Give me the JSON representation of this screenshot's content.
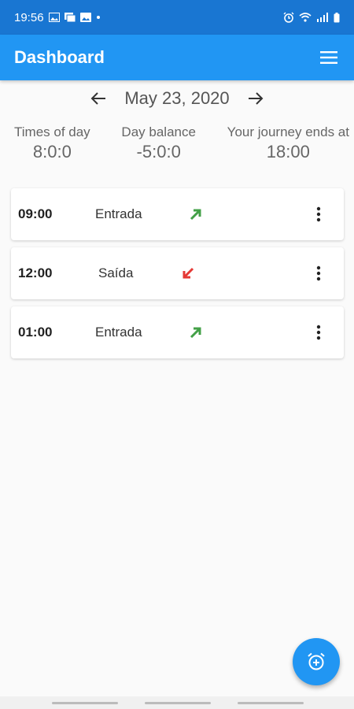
{
  "status_bar": {
    "time": "19:56",
    "left_icons": [
      "image-icon",
      "messages-icon",
      "photo-icon",
      "dot-icon"
    ],
    "right_icons": [
      "alarm-icon",
      "wifi-icon",
      "signal-icon",
      "battery-icon"
    ]
  },
  "app_bar": {
    "title": "Dashboard",
    "menu_icon": "hamburger-menu-icon"
  },
  "date_nav": {
    "date": "May 23, 2020",
    "prev_icon": "arrow-left-icon",
    "next_icon": "arrow-right-icon"
  },
  "summary": [
    {
      "label": "Times of day",
      "value": "8:0:0"
    },
    {
      "label": "Day balance",
      "value": "-5:0:0"
    },
    {
      "label": "Your journey ends at",
      "value": "18:00"
    }
  ],
  "records": [
    {
      "time": "09:00",
      "type": "Entrada",
      "direction": "in",
      "arrow_color": "#43a047"
    },
    {
      "time": "12:00",
      "type": "Saída",
      "direction": "out",
      "arrow_color": "#e53935"
    },
    {
      "time": "01:00",
      "type": "Entrada",
      "direction": "in",
      "arrow_color": "#43a047"
    }
  ],
  "fab": {
    "icon": "add-alarm-icon"
  },
  "colors": {
    "status_bar": "#1976d2",
    "app_bar": "#2196f3",
    "arrow_in": "#43a047",
    "arrow_out": "#e53935"
  }
}
